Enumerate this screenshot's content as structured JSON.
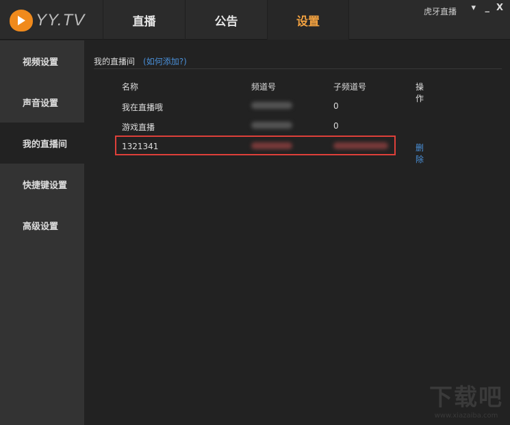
{
  "app": {
    "logo": "YY.TV",
    "top_link": "虎牙直播"
  },
  "tabs": [
    {
      "label": "直播"
    },
    {
      "label": "公告"
    },
    {
      "label": "设置"
    }
  ],
  "sidebar": {
    "items": [
      {
        "label": "视频设置"
      },
      {
        "label": "声音设置"
      },
      {
        "label": "我的直播间"
      },
      {
        "label": "快捷键设置"
      },
      {
        "label": "高级设置"
      }
    ]
  },
  "section": {
    "title": "我的直播间",
    "help": "(如何添加?)"
  },
  "table": {
    "headers": [
      "名称",
      "频道号",
      "子频道号",
      "操作"
    ],
    "rows": [
      {
        "name": "我在直播哦",
        "sub": "0"
      },
      {
        "name": "游戏直播",
        "sub": "0"
      },
      {
        "name": "1321341",
        "action": "删除"
      }
    ]
  },
  "watermark": {
    "title": "下载吧",
    "url": "www.xiazaiba.com"
  },
  "colors": {
    "accent": "#f0a040",
    "link": "#4a90d9",
    "highlight": "#e0403a"
  }
}
